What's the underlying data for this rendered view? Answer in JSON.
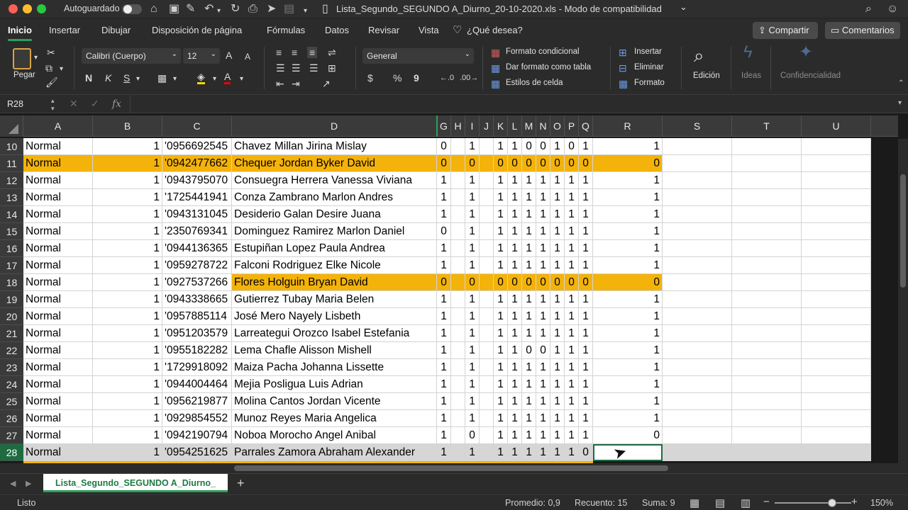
{
  "window": {
    "autosave_label": "Autoguardado",
    "title": "Lista_Segundo_SEGUNDO A_Diurno_20-10-2020.xls  -  Modo de compatibilidad",
    "title_chevron": "⌄"
  },
  "tabs": [
    "Inicio",
    "Insertar",
    "Dibujar",
    "Disposición de página",
    "Fórmulas",
    "Datos",
    "Revisar",
    "Vista"
  ],
  "tell_me": "¿Qué desea?",
  "share_label": "Compartir",
  "comments_label": "Comentarios",
  "ribbon": {
    "paste_label": "Pegar",
    "font_name": "Calibri (Cuerpo)",
    "font_size": "12",
    "number_format": "General",
    "cond_format": "Formato condicional",
    "table_format": "Dar formato como tabla",
    "cell_styles": "Estilos de celda",
    "insert": "Insertar",
    "delete": "Eliminar",
    "format": "Formato",
    "edit": "Edición",
    "ideas": "Ideas",
    "confidential": "Confidencialidad",
    "bold": "N",
    "italic": "K",
    "underline": "S",
    "grow_font": "A",
    "shrink_font": "A",
    "currency": "$",
    "percent": "%",
    "thousands": "9"
  },
  "formula_bar": {
    "name_box": "R28",
    "fx": "fx",
    "value": ""
  },
  "columns": [
    "A",
    "B",
    "C",
    "D",
    "G",
    "H",
    "I",
    "J",
    "K",
    "L",
    "M",
    "N",
    "O",
    "P",
    "Q",
    "R",
    "S",
    "T",
    "U"
  ],
  "rows": [
    {
      "n": "10",
      "a": "Normal",
      "b": "1",
      "c": "'0956692545",
      "d": "Chavez Millan Jirina Mislay",
      "g": "0",
      "h": "",
      "i": "1",
      "j": "",
      "k": "1",
      "l": "1",
      "m": "0",
      "nn": "0",
      "o": "1",
      "p": "0",
      "q": "1",
      "r": "1",
      "hl": "none"
    },
    {
      "n": "11",
      "a": "Normal",
      "b": "1",
      "c": "'0942477662",
      "d": "Chequer Jordan Byker David",
      "g": "0",
      "h": "",
      "i": "0",
      "j": "",
      "k": "0",
      "l": "0",
      "m": "0",
      "nn": "0",
      "o": "0",
      "p": "0",
      "q": "0",
      "r": "0",
      "hl": "full"
    },
    {
      "n": "12",
      "a": "Normal",
      "b": "1",
      "c": "'0943795070",
      "d": "Consuegra Herrera Vanessa Viviana",
      "g": "1",
      "h": "",
      "i": "1",
      "j": "",
      "k": "1",
      "l": "1",
      "m": "1",
      "nn": "1",
      "o": "1",
      "p": "1",
      "q": "1",
      "r": "1",
      "hl": "none"
    },
    {
      "n": "13",
      "a": "Normal",
      "b": "1",
      "c": "'1725441941",
      "d": "Conza Zambrano Marlon Andres",
      "g": "1",
      "h": "",
      "i": "1",
      "j": "",
      "k": "1",
      "l": "1",
      "m": "1",
      "nn": "1",
      "o": "1",
      "p": "1",
      "q": "1",
      "r": "1",
      "hl": "none"
    },
    {
      "n": "14",
      "a": "Normal",
      "b": "1",
      "c": "'0943131045",
      "d": "Desiderio Galan Desire Juana",
      "g": "1",
      "h": "",
      "i": "1",
      "j": "",
      "k": "1",
      "l": "1",
      "m": "1",
      "nn": "1",
      "o": "1",
      "p": "1",
      "q": "1",
      "r": "1",
      "hl": "none"
    },
    {
      "n": "15",
      "a": "Normal",
      "b": "1",
      "c": "'2350769341",
      "d": "Dominguez Ramirez Marlon Daniel",
      "g": "0",
      "h": "",
      "i": "1",
      "j": "",
      "k": "1",
      "l": "1",
      "m": "1",
      "nn": "1",
      "o": "1",
      "p": "1",
      "q": "1",
      "r": "1",
      "hl": "none"
    },
    {
      "n": "16",
      "a": "Normal",
      "b": "1",
      "c": "'0944136365",
      "d": "Estupiñan Lopez Paula Andrea",
      "g": "1",
      "h": "",
      "i": "1",
      "j": "",
      "k": "1",
      "l": "1",
      "m": "1",
      "nn": "1",
      "o": "1",
      "p": "1",
      "q": "1",
      "r": "1",
      "hl": "none"
    },
    {
      "n": "17",
      "a": "Normal",
      "b": "1",
      "c": "'0959278722",
      "d": "Falconi Rodriguez Elke Nicole",
      "g": "1",
      "h": "",
      "i": "1",
      "j": "",
      "k": "1",
      "l": "1",
      "m": "1",
      "nn": "1",
      "o": "1",
      "p": "1",
      "q": "1",
      "r": "1",
      "hl": "none"
    },
    {
      "n": "18",
      "a": "Normal",
      "b": "1",
      "c": "'0927537266",
      "d": "Flores Holguin Bryan David",
      "g": "0",
      "h": "",
      "i": "0",
      "j": "",
      "k": "0",
      "l": "0",
      "m": "0",
      "nn": "0",
      "o": "0",
      "p": "0",
      "q": "0",
      "r": "0",
      "hl": "partial"
    },
    {
      "n": "19",
      "a": "Normal",
      "b": "1",
      "c": "'0943338665",
      "d": "Gutierrez Tubay Maria Belen",
      "g": "1",
      "h": "",
      "i": "1",
      "j": "",
      "k": "1",
      "l": "1",
      "m": "1",
      "nn": "1",
      "o": "1",
      "p": "1",
      "q": "1",
      "r": "1",
      "hl": "none"
    },
    {
      "n": "20",
      "a": "Normal",
      "b": "1",
      "c": "'0957885114",
      "d": "José Mero Nayely Lisbeth",
      "g": "1",
      "h": "",
      "i": "1",
      "j": "",
      "k": "1",
      "l": "1",
      "m": "1",
      "nn": "1",
      "o": "1",
      "p": "1",
      "q": "1",
      "r": "1",
      "hl": "none"
    },
    {
      "n": "21",
      "a": "Normal",
      "b": "1",
      "c": "'0951203579",
      "d": "Larreategui Orozco Isabel Estefania",
      "g": "1",
      "h": "",
      "i": "1",
      "j": "",
      "k": "1",
      "l": "1",
      "m": "1",
      "nn": "1",
      "o": "1",
      "p": "1",
      "q": "1",
      "r": "1",
      "hl": "none"
    },
    {
      "n": "22",
      "a": "Normal",
      "b": "1",
      "c": "'0955182282",
      "d": "Lema Chafle Alisson Mishell",
      "g": "1",
      "h": "",
      "i": "1",
      "j": "",
      "k": "1",
      "l": "1",
      "m": "0",
      "nn": "0",
      "o": "1",
      "p": "1",
      "q": "1",
      "r": "1",
      "hl": "none"
    },
    {
      "n": "23",
      "a": "Normal",
      "b": "1",
      "c": "'1729918092",
      "d": "Maiza Pacha Johanna Lissette",
      "g": "1",
      "h": "",
      "i": "1",
      "j": "",
      "k": "1",
      "l": "1",
      "m": "1",
      "nn": "1",
      "o": "1",
      "p": "1",
      "q": "1",
      "r": "1",
      "hl": "none"
    },
    {
      "n": "24",
      "a": "Normal",
      "b": "1",
      "c": "'0944004464",
      "d": "Mejia Posligua Luis Adrian",
      "g": "1",
      "h": "",
      "i": "1",
      "j": "",
      "k": "1",
      "l": "1",
      "m": "1",
      "nn": "1",
      "o": "1",
      "p": "1",
      "q": "1",
      "r": "1",
      "hl": "none"
    },
    {
      "n": "25",
      "a": "Normal",
      "b": "1",
      "c": "'0956219877",
      "d": "Molina Cantos Jordan Vicente",
      "g": "1",
      "h": "",
      "i": "1",
      "j": "",
      "k": "1",
      "l": "1",
      "m": "1",
      "nn": "1",
      "o": "1",
      "p": "1",
      "q": "1",
      "r": "1",
      "hl": "none"
    },
    {
      "n": "26",
      "a": "Normal",
      "b": "1",
      "c": "'0929854552",
      "d": "Munoz Reyes Maria Angelica",
      "g": "1",
      "h": "",
      "i": "1",
      "j": "",
      "k": "1",
      "l": "1",
      "m": "1",
      "nn": "1",
      "o": "1",
      "p": "1",
      "q": "1",
      "r": "1",
      "hl": "none"
    },
    {
      "n": "27",
      "a": "Normal",
      "b": "1",
      "c": "'0942190794",
      "d": "Noboa Morocho Angel Anibal",
      "g": "1",
      "h": "",
      "i": "0",
      "j": "",
      "k": "1",
      "l": "1",
      "m": "1",
      "nn": "1",
      "o": "1",
      "p": "1",
      "q": "1",
      "r": "0",
      "hl": "none"
    },
    {
      "n": "28",
      "a": "Normal",
      "b": "1",
      "c": "'0954251625",
      "d": "Parrales Zamora Abraham Alexander",
      "g": "1",
      "h": "",
      "i": "1",
      "j": "",
      "k": "1",
      "l": "1",
      "m": "1",
      "nn": "1",
      "o": "1",
      "p": "1",
      "q": "0",
      "r": "",
      "hl": "selected"
    }
  ],
  "sheet_tab": "Lista_Segundo_SEGUNDO A_Diurno_",
  "add_sheet": "+",
  "status": {
    "ready": "Listo",
    "average": "Promedio: 0,9",
    "count": "Recuento: 15",
    "sum": "Suma: 9",
    "zoom": "150%",
    "zoom_minus": "−",
    "zoom_plus": "+",
    "zoom_fraction": 0.75
  },
  "colors": {
    "highlight": "#f4b30a",
    "selection": "#1e6b41",
    "accent_green": "#2f9e5b"
  }
}
